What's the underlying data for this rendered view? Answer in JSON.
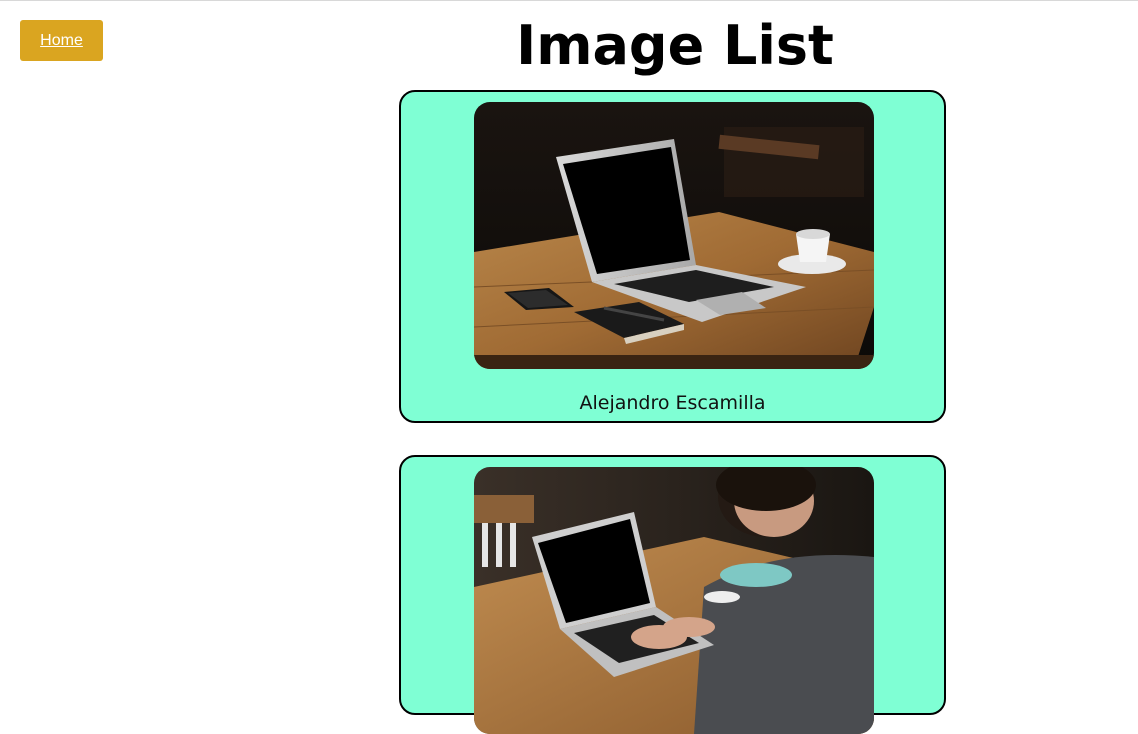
{
  "nav": {
    "home_label": "Home"
  },
  "page": {
    "title": "Image List"
  },
  "images": [
    {
      "author": "Alejandro Escamilla",
      "photo": "laptop-on-desk-photo"
    },
    {
      "author": "",
      "photo": "person-typing-on-laptop-photo"
    }
  ]
}
